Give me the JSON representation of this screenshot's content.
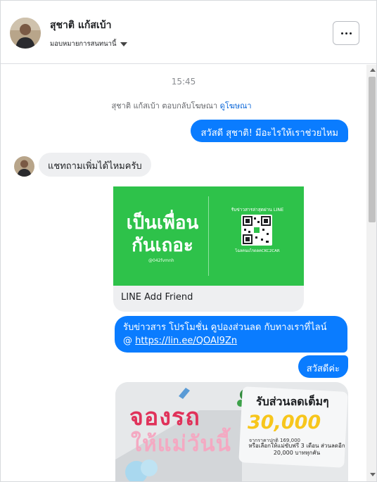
{
  "header": {
    "contact_name": "สุชาติ แก้สเบ้า",
    "assignment_label": "มอบหมายการสนทนานี้",
    "more_icon": "more-horizontal-icon"
  },
  "chat": {
    "timestamp": "15:45",
    "reply_note": {
      "text": "สุชาติ แก้สเบ้า ตอบกลับโฆษณา",
      "link": "ดูโฆษณา"
    },
    "messages": [
      {
        "direction": "out",
        "text": "สวัสดี สุชาติ! มีอะไรให้เราช่วยไหม"
      },
      {
        "direction": "in",
        "text": "แชทถามเพิ่มได้ไหมครับ"
      },
      {
        "direction": "out",
        "type": "card",
        "title": "LINE Add Friend",
        "image_text": {
          "headline_1": "เป็นเพื่อน",
          "headline_2": "กันเถอะ",
          "line_id": "@042fvmnh",
          "qr_caption": "รับข่าวสารล่าสุดผ่าน LINE",
          "qr_bottom": "โฉลคนแไรดดคCKC2CAR"
        }
      },
      {
        "direction": "out",
        "text_line1": "รับข่าวสาร  โปรโมชั่น คูปองส่วนลด กับทางเราที่ไลน์",
        "text_line2_prefix": "@  ",
        "link": "https://lin.ee/QOAI9Zn"
      },
      {
        "direction": "out",
        "text": "สวัสดีค่ะ"
      },
      {
        "direction": "out",
        "type": "image",
        "image_text": {
          "title_1": "จองรถ",
          "title_2": "ให้แม่วันนี้",
          "headline": "รับส่วนลดเต็มๆ",
          "amount": "30,000",
          "sub": "จากราคาปกติ 169,000",
          "detail": "หรือเลือกให้แม่ขับฟรี 3 เดือน ส่วนลดอีก 20,000 บาททุกคัน"
        }
      }
    ]
  },
  "colors": {
    "outgoing_bubble": "#0a7cff",
    "incoming_bubble": "#eeeff1",
    "link": "#0a66d8",
    "line_green": "#2ec24a"
  }
}
